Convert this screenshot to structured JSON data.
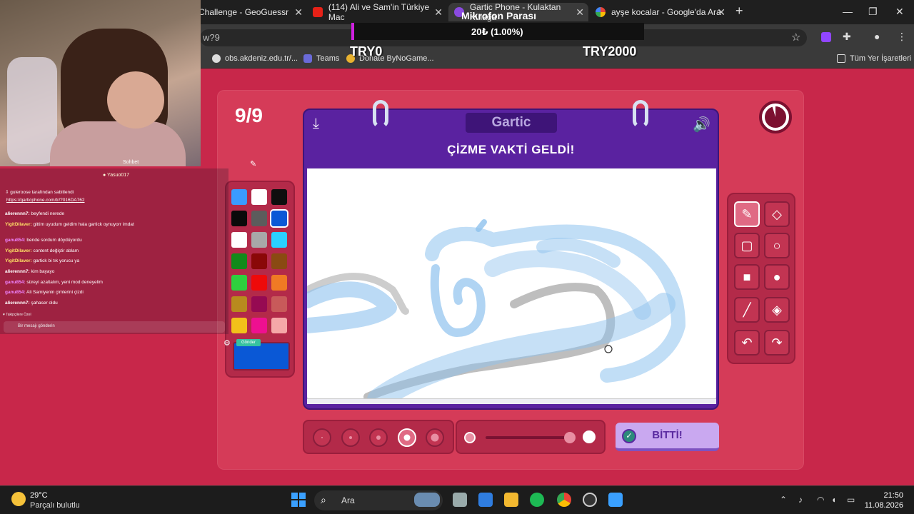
{
  "browser": {
    "tabs": [
      {
        "label": "Challenge - GeoGuessr"
      },
      {
        "label": "(114) Ali ve Sam'in Türkiye Mac"
      },
      {
        "label": "Gartic Phone - Kulaktan Kulağa"
      },
      {
        "label": "ayşe kocalar - Google'da Ara"
      }
    ],
    "url": "w?9",
    "bookmarks": [
      "obs.akdeniz.edu.tr/...",
      "Teams",
      "Donate ByNoGame..."
    ],
    "all_bookmarks": "Tüm Yer İşaretleri"
  },
  "donation": {
    "title": "Mikrofon Parası",
    "progress_text": "20₺ (1.00%)",
    "progress": 0.01,
    "min": "TRY0",
    "max": "TRY2000"
  },
  "stream": {
    "cam_label": "Sohbet",
    "chat_top": "Yasuo017",
    "pinned_by": "guleroose tarafından sabitlendi",
    "pinned_link": "https://garticphone.com/tr/?016DA762",
    "messages": [
      {
        "user": "alierennn7:",
        "text": "beyfendi nerede"
      },
      {
        "user": "YigitDilaver:",
        "text": "gittim uyudum geldim hala gartick oynuyorr imdat"
      },
      {
        "user": "ganu854:",
        "text": "bende sordum döydüyordu"
      },
      {
        "user": "YigitDilaver:",
        "text": "content değiştir ablam"
      },
      {
        "user": "YigitDilaver:",
        "text": "gartick bi tık yorucu ya"
      },
      {
        "user": "alierennn7:",
        "text": "kim bayayo"
      },
      {
        "user": "ganu854:",
        "text": "süreyi azaltalım, yeni mod deneyelim"
      },
      {
        "user": "ganu854:",
        "text": "Ali Samiyenin çimlerini çizdi"
      },
      {
        "user": "alierennn7:",
        "text": "şahaser oldu"
      }
    ],
    "footer": "Takipçilere Özel",
    "input_placeholder": "Bir mesajı gönderin",
    "send_label": "Gönder"
  },
  "game": {
    "round": "9/9",
    "logo": "Gartic",
    "heading": "ÇİZME VAKTİ GELDİ!",
    "done_label": "BİTTİ!",
    "palette": [
      "#3a9bff",
      "#ffffff",
      "#0e0e0e",
      "#0a0a0a",
      "#5c5c5c",
      "#0a58d6",
      "#ffffff",
      "#a8a8a8",
      "#2ad0ff",
      "#128a1a",
      "#8a0808",
      "#8a4a12",
      "#2ed03e",
      "#ee0a0a",
      "#f07a24",
      "#b88a1e",
      "#960a52",
      "#c85a5a",
      "#f2c11a",
      "#ee1090",
      "#f5a8a8"
    ],
    "selected_color": "#0a58d6",
    "brush_sizes": 5,
    "selected_size": 4,
    "tools": [
      "pencil-icon",
      "eraser-icon",
      "rectangle-outline-icon",
      "ellipse-outline-icon",
      "rectangle-fill-icon",
      "ellipse-fill-icon",
      "line-icon",
      "fill-bucket-icon",
      "undo-icon",
      "redo-icon"
    ]
  },
  "taskbar": {
    "temp": "29°C",
    "weather": "Parçalı bulutlu",
    "search": "Ara",
    "time": "21:50",
    "date": "11.08.2026"
  }
}
